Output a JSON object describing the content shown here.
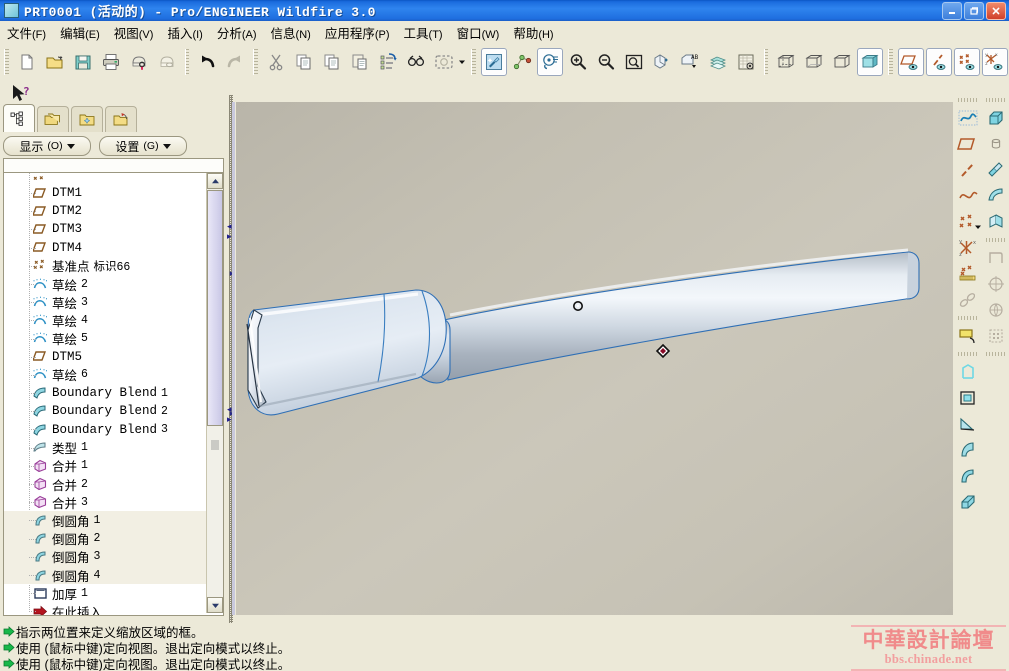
{
  "window": {
    "title": "PRT0001 (活动的) - Pro/ENGINEER Wildfire 3.0",
    "icon": "part-window-icon",
    "minimize_label": "_",
    "restore_label": "❐",
    "close_label": "✕"
  },
  "menubar": {
    "items": [
      {
        "name": "file",
        "label": "文件",
        "accel": "(F)"
      },
      {
        "name": "edit",
        "label": "编辑",
        "accel": "(E)"
      },
      {
        "name": "view",
        "label": "视图",
        "accel": "(V)"
      },
      {
        "name": "insert",
        "label": "插入",
        "accel": "(I)"
      },
      {
        "name": "analysis",
        "label": "分析",
        "accel": "(A)"
      },
      {
        "name": "info",
        "label": "信息",
        "accel": "(N)"
      },
      {
        "name": "applications",
        "label": "应用程序",
        "accel": "(P)"
      },
      {
        "name": "tools",
        "label": "工具",
        "accel": "(T)"
      },
      {
        "name": "window",
        "label": "窗口",
        "accel": "(W)"
      },
      {
        "name": "help",
        "label": "帮助",
        "accel": "(H)"
      }
    ]
  },
  "toolbar": {
    "groups": [
      [
        "new-file-icon",
        "open-folder-icon",
        "save-icon",
        "print-icon",
        "print-preview-icon",
        "mail-icon"
      ],
      [
        "undo-icon",
        "redo-icon"
      ],
      [
        "cut-icon",
        "copy-icon",
        "paste-special-icon",
        "paste-icon",
        "regenerate-icon",
        "find-icon",
        "select-box-icon"
      ],
      [
        "repaint-icon",
        "datum-display-icon",
        "spin-center-icon",
        "zoom-in-icon",
        "zoom-out-icon",
        "refit-icon",
        "view-manager-icon",
        "annotation-icon",
        "layers-icon",
        "render-icon"
      ],
      [
        "wireframe-icon",
        "hidden-line-icon",
        "no-hidden-icon",
        "shading-icon"
      ],
      [
        "datum-plane-display-icon",
        "datum-axis-display-icon",
        "datum-point-display-icon",
        "datum-csys-display-icon"
      ]
    ],
    "active_icons": [
      "spin-center-icon",
      "shading-icon",
      "datum-plane-display-icon",
      "datum-axis-display-icon",
      "datum-point-display-icon",
      "datum-csys-display-icon"
    ]
  },
  "tree_panel": {
    "tabs": [
      {
        "name": "model-tree-tab",
        "icon": "model-tree-icon",
        "selected": true
      },
      {
        "name": "layer-tree-tab",
        "icon": "folders-icon",
        "selected": false
      },
      {
        "name": "folder-browser-tab",
        "icon": "folder-star-icon",
        "selected": false
      },
      {
        "name": "favorites-tab",
        "icon": "folder-favorites-icon",
        "selected": false
      }
    ],
    "buttons": [
      {
        "name": "show-menu-button",
        "label": "显示",
        "accel": "(O)"
      },
      {
        "name": "settings-menu-button",
        "label": "设置",
        "accel": "(G)"
      }
    ],
    "scroll": {
      "up_arrow": "▲",
      "down_arrow": "▼"
    },
    "items": [
      {
        "label": "DTM1",
        "num": "",
        "icon": "datum-plane-icon"
      },
      {
        "label": "DTM2",
        "num": "",
        "icon": "datum-plane-icon"
      },
      {
        "label": "DTM3",
        "num": "",
        "icon": "datum-plane-icon"
      },
      {
        "label": "DTM4",
        "num": "",
        "icon": "datum-plane-icon"
      },
      {
        "label": "基准点",
        "num": "标识66",
        "icon": "datum-point-icon"
      },
      {
        "label": "草绘",
        "num": "2",
        "icon": "sketch-icon"
      },
      {
        "label": "草绘",
        "num": "3",
        "icon": "sketch-icon"
      },
      {
        "label": "草绘",
        "num": "4",
        "icon": "sketch-icon"
      },
      {
        "label": "草绘",
        "num": "5",
        "icon": "sketch-icon"
      },
      {
        "label": "DTM5",
        "num": "",
        "icon": "datum-plane-icon"
      },
      {
        "label": "草绘",
        "num": "6",
        "icon": "sketch-icon"
      },
      {
        "label": "Boundary Blend",
        "num": "1",
        "icon": "boundary-blend-icon"
      },
      {
        "label": "Boundary Blend",
        "num": "2",
        "icon": "boundary-blend-icon"
      },
      {
        "label": "Boundary Blend",
        "num": "3",
        "icon": "boundary-blend-icon"
      },
      {
        "label": "类型",
        "num": "1",
        "icon": "surface-type-icon"
      },
      {
        "label": "合并",
        "num": "1",
        "icon": "merge-icon"
      },
      {
        "label": "合并",
        "num": "2",
        "icon": "merge-icon"
      },
      {
        "label": "合并",
        "num": "3",
        "icon": "merge-icon"
      },
      {
        "label": "倒圆角",
        "num": "1",
        "icon": "round-icon"
      },
      {
        "label": "倒圆角",
        "num": "2",
        "icon": "round-icon"
      },
      {
        "label": "倒圆角",
        "num": "3",
        "icon": "round-icon"
      },
      {
        "label": "倒圆角",
        "num": "4",
        "icon": "round-icon"
      },
      {
        "label": "加厚",
        "num": "1",
        "icon": "thicken-icon"
      },
      {
        "label": "在此插入",
        "num": "",
        "icon": "insert-here-icon"
      }
    ]
  },
  "graphics": {
    "model_name": "tapered-handle-blade-surface-model",
    "spin_center_marker": "spin-center-marker",
    "datum_point_marker": "datum-point-marker",
    "background_top": "#b9b5a9",
    "background_bottom": "#bdb9ad",
    "part_color": "#ccd9e6",
    "edge_color": "#2f6fb5"
  },
  "right_toolbar_1": {
    "icons": [
      "sketch-curve-icon",
      "datum-plane-icon",
      "datum-axis-icon",
      "curve-icon",
      "datum-point-icon",
      "datum-csys-icon",
      "analysis-point-icon",
      "datum-offset-icon",
      "sketch-tool-icon",
      "extrude-icon",
      "revolve-icon",
      "sweep-icon",
      "variable-sweep-icon",
      "round-tool-icon",
      "chamfer-tool-icon"
    ]
  },
  "right_toolbar_2": {
    "icons": [
      "extrude-solid-icon",
      "hole-icon",
      "paint-surface-icon",
      "shell-icon",
      "draft-icon",
      "rib-icon",
      "pattern-icon",
      "copy-geom-icon",
      "mirror-icon"
    ]
  },
  "statusbar": {
    "lines": [
      "指示两位置来定义缩放区域的框。",
      "使用 (鼠标中键)定向视图。退出定向模式以终止。",
      "使用 (鼠标中键)定向视图。退出定向模式以终止。"
    ],
    "arrow_icon": "green-arrow-icon"
  },
  "watermark": {
    "cjk": "中華設計論壇",
    "url": "bbs.chinade.net"
  }
}
